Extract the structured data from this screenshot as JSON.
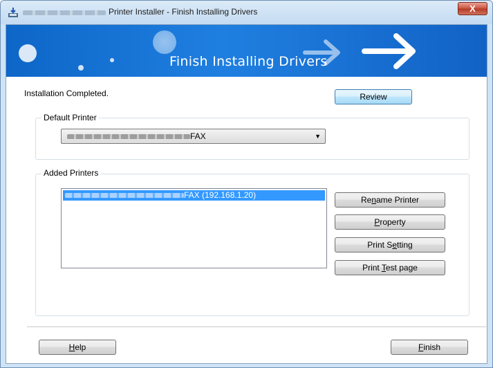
{
  "window": {
    "title": "Printer Installer - Finish Installing Drivers",
    "close_glyph": "X"
  },
  "banner": {
    "title": "Finish Installing Drivers"
  },
  "status": {
    "text": "Installation Completed."
  },
  "buttons": {
    "review": "Review",
    "rename_printer": {
      "pre": "Re",
      "key": "n",
      "post": "ame Printer"
    },
    "property": {
      "pre": "",
      "key": "P",
      "post": "roperty"
    },
    "print_setting": {
      "pre": "Print S",
      "key": "e",
      "post": "tting"
    },
    "print_test_page": {
      "pre": "Print ",
      "key": "T",
      "post": "est page"
    },
    "help": {
      "pre": "",
      "key": "H",
      "post": "elp"
    },
    "finish": {
      "pre": "",
      "key": "F",
      "post": "inish"
    }
  },
  "default_printer": {
    "label": "Default Printer",
    "selected_suffix": "FAX"
  },
  "added_printers": {
    "label": "Added Printers",
    "items": [
      {
        "suffix": "FAX (192.168.1.20)"
      }
    ]
  },
  "icons": {
    "app_icon": "download-printer-icon",
    "dropdown_icon": "triangle-down-icon"
  },
  "colors": {
    "banner_blue": "#1f7fe0",
    "selection_blue": "#3399ff",
    "close_red": "#c9523d"
  }
}
